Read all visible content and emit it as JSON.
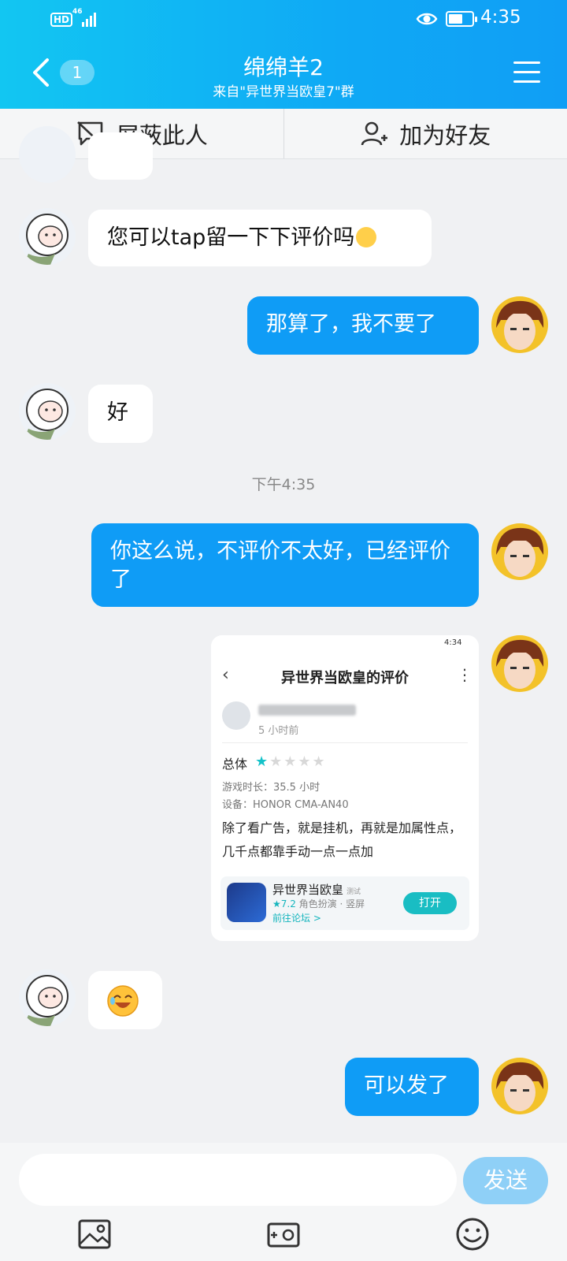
{
  "status_bar": {
    "hd": "HD",
    "network": "46",
    "time": "4:35",
    "battery_level": 0.6
  },
  "header": {
    "badge": "1",
    "title": "绵绵羊2",
    "subtitle": "来自\"异世界当欧皇7\"群"
  },
  "actions": {
    "block": "屏蔽此人",
    "add_friend": "加为好友"
  },
  "messages": [
    {
      "from": "other",
      "text": "您可以tap留一下下评价吗"
    },
    {
      "from": "me",
      "text": "那算了，我不要了"
    },
    {
      "from": "other",
      "text": "好"
    },
    {
      "timestamp": "下午4:35"
    },
    {
      "from": "me",
      "text": "你这么说，不评价不太好，已经评价了"
    },
    {
      "from": "me",
      "type": "image"
    },
    {
      "from": "other",
      "type": "emoji"
    },
    {
      "from": "me",
      "text": "可以发了"
    }
  ],
  "screenshot_card": {
    "status_time": "4:34",
    "title": "异世界当欧皇的评价",
    "time_ago": "5 小时前",
    "overall_label": "总体",
    "rating": 1,
    "rating_max": 5,
    "play_time": "游戏时长：35.5 小时",
    "device": "设备：HONOR CMA-AN40",
    "review": "除了看广告，就是挂机，再就是加属性点，几千点都靠手动一点一点加",
    "game_name": "异世界当欧皇",
    "game_tag": "测试",
    "game_score": "★7.2",
    "game_meta": "角色扮演 · 竖屏",
    "game_forum": "前往论坛 >",
    "open_button": "打开"
  },
  "input": {
    "value": "",
    "send_label": "发送"
  },
  "colors": {
    "header": "#0fa9f5",
    "out_bubble": "#0f9cf6",
    "send": "#8fd0f7",
    "accent": "#19bdc3"
  }
}
